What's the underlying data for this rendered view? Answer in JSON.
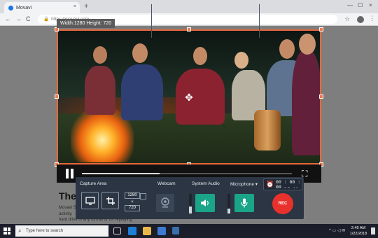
{
  "browser": {
    "tab_title": "Movavi",
    "url": "https://movavi.com",
    "new_tab_symbol": "+",
    "close_tab_symbol": "×",
    "back_symbol": "←",
    "forward_symbol": "→",
    "reload_symbol": "C",
    "star_symbol": "☆",
    "menu_symbol": "⋮",
    "minimize_symbol": "—",
    "maximize_symbol": "☐",
    "close_symbol": "×"
  },
  "page": {
    "heading": "The",
    "paragraph": "Movavi S activity.",
    "paragraph_line2": "hard drive in any format or for replaying"
  },
  "capture": {
    "size_label": "Width:1280 Height: 720"
  },
  "video": {
    "progress_fraction": 0.37
  },
  "recorder": {
    "capture_area_label": "Capture Area",
    "width_value": "1280",
    "height_value": "720",
    "times_symbol": "×",
    "webcam_label": "Webcam",
    "system_audio_label": "System Audio",
    "microphone_label": "Microphone ▾",
    "timer": "00 : 00 : 00",
    "timer_units": "hh mm ss",
    "rec_label": "REC",
    "system_audio_level": 0.35,
    "microphone_level": 0.25,
    "accent_color": "#1aa589",
    "rec_color": "#e8312c"
  },
  "taskbar": {
    "search_placeholder": "Type here to search",
    "time": "2:45 AM",
    "date": "1/22/2018"
  }
}
